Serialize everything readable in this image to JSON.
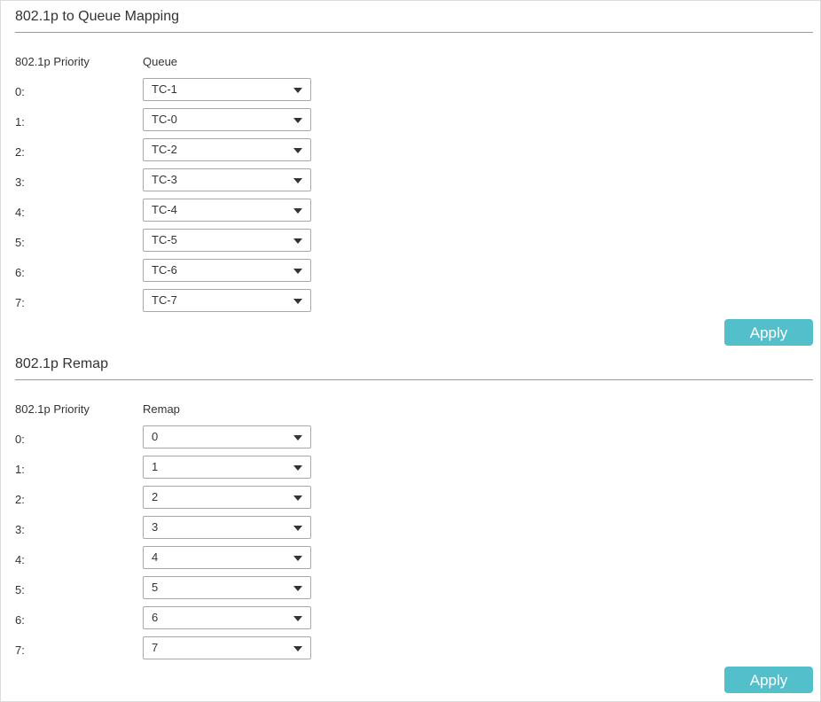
{
  "mapping": {
    "title": "802.1p to Queue Mapping",
    "col_priority": "802.1p Priority",
    "col_value": "Queue",
    "rows": [
      {
        "label": "0:",
        "value": "TC-1"
      },
      {
        "label": "1:",
        "value": "TC-0"
      },
      {
        "label": "2:",
        "value": "TC-2"
      },
      {
        "label": "3:",
        "value": "TC-3"
      },
      {
        "label": "4:",
        "value": "TC-4"
      },
      {
        "label": "5:",
        "value": "TC-5"
      },
      {
        "label": "6:",
        "value": "TC-6"
      },
      {
        "label": "7:",
        "value": "TC-7"
      }
    ],
    "apply_label": "Apply"
  },
  "remap": {
    "title": "802.1p Remap",
    "col_priority": "802.1p Priority",
    "col_value": "Remap",
    "rows": [
      {
        "label": "0:",
        "value": "0"
      },
      {
        "label": "1:",
        "value": "1"
      },
      {
        "label": "2:",
        "value": "2"
      },
      {
        "label": "3:",
        "value": "3"
      },
      {
        "label": "4:",
        "value": "4"
      },
      {
        "label": "5:",
        "value": "5"
      },
      {
        "label": "6:",
        "value": "6"
      },
      {
        "label": "7:",
        "value": "7"
      }
    ],
    "apply_label": "Apply"
  },
  "colors": {
    "accent": "#52bfca",
    "divider": "#999999",
    "border": "#a9a9a9"
  }
}
